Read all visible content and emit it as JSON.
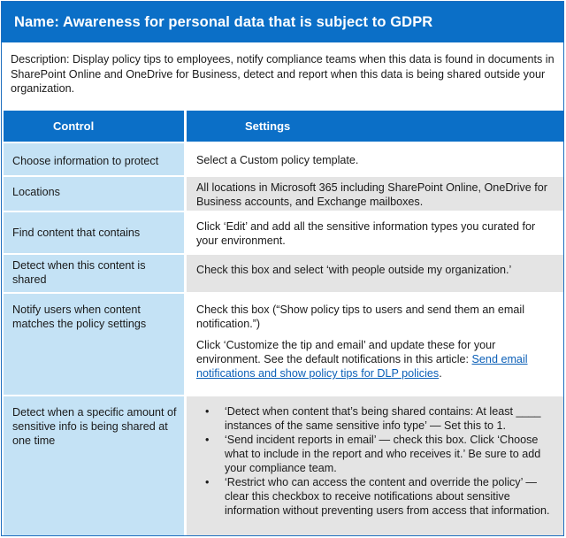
{
  "title": "Name: Awareness for personal data that is subject to GDPR",
  "description": "Description: Display policy tips to employees, notify compliance teams when this data is found in documents in SharePoint Online and OneDrive for Business, detect and report when this data is being shared outside your organization.",
  "headers": {
    "control": "Control",
    "settings": "Settings"
  },
  "rows": [
    {
      "control": "Choose information to protect",
      "setting": "Select a Custom policy template."
    },
    {
      "control": "Locations",
      "setting": "All locations in Microsoft 365 including SharePoint Online, OneDrive for Business accounts, and Exchange mailboxes."
    },
    {
      "control": "Find content that contains",
      "setting": "Click ‘Edit’ and add all the sensitive information types you curated for your environment."
    },
    {
      "control": "Detect when this content is shared",
      "setting": "Check this box and select ‘with people outside my organization.’"
    },
    {
      "control": "Notify users when content matches the policy settings",
      "setting_p1": "Check this box (“Show policy tips to users and send them an email notification.”)",
      "setting_p2": "Click ‘Customize the tip and email’ and update these for your environment. See the default notifications in this article: ",
      "setting_link": "Send email notifications and show policy tips for DLP policies",
      "setting_p2_end": "."
    },
    {
      "control": "Detect when a specific amount of sensitive info is being shared at one time",
      "bullets": [
        "‘Detect when content that’s being shared contains: At least ____ instances of the same sensitive info type’ — Set this to 1.",
        "‘Send incident reports in email’ — check this box. Click ‘Choose what to include in the report and who receives it.’ Be sure to add your compliance team.",
        " ‘Restrict who can access the content and override the policy’ — clear this checkbox to receive notifications about sensitive information without preventing users from access that information."
      ]
    }
  ],
  "bullet_glyph": "•",
  "colors": {
    "header_blue": "#0b6fc7",
    "control_cell": "#c4e2f5",
    "settings_gray": "#e4e4e4",
    "link": "#0b5fb7"
  }
}
